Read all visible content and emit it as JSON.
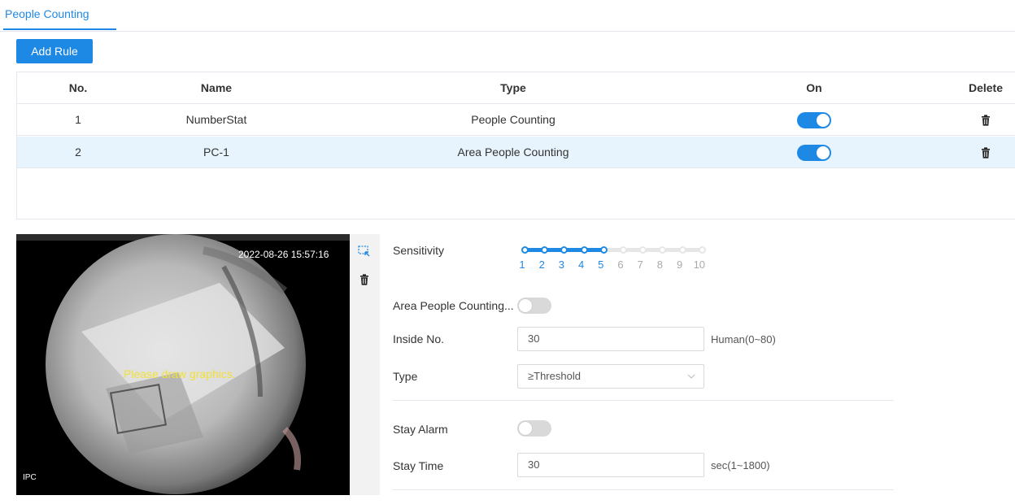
{
  "tabs": [
    {
      "label": "People Counting"
    }
  ],
  "toolbar": {
    "add_rule_label": "Add Rule"
  },
  "table": {
    "headers": {
      "no": "No.",
      "name": "Name",
      "type": "Type",
      "on": "On",
      "delete": "Delete"
    },
    "rows": [
      {
        "no": "1",
        "name": "NumberStat",
        "type": "People Counting",
        "on": true
      },
      {
        "no": "2",
        "name": "PC-1",
        "type": "Area People Counting",
        "on": true
      }
    ]
  },
  "video": {
    "timestamp": "2022-08-26 15:57:16",
    "hint": "Please draw graphics.",
    "channel_label": "IPC"
  },
  "form": {
    "sensitivity": {
      "label": "Sensitivity",
      "value": 5,
      "scale": [
        "1",
        "2",
        "3",
        "4",
        "5",
        "6",
        "7",
        "8",
        "9",
        "10"
      ]
    },
    "area_people_counting": {
      "label": "Area People Counting...",
      "on": false
    },
    "inside_no": {
      "label": "Inside No.",
      "value": "30",
      "unit": "Human(0~80)"
    },
    "type": {
      "label": "Type",
      "value": "≥Threshold"
    },
    "stay_alarm": {
      "label": "Stay Alarm",
      "on": false
    },
    "stay_time": {
      "label": "Stay Time",
      "value": "30",
      "unit": "sec(1~1800)"
    }
  },
  "colors": {
    "accent": "#1e88e5",
    "selected_row": "#e8f4fd",
    "hint_text": "#f2e03a"
  },
  "icons": {
    "draw": "select-area-icon",
    "clear": "trash-icon",
    "delete": "trash-icon"
  }
}
